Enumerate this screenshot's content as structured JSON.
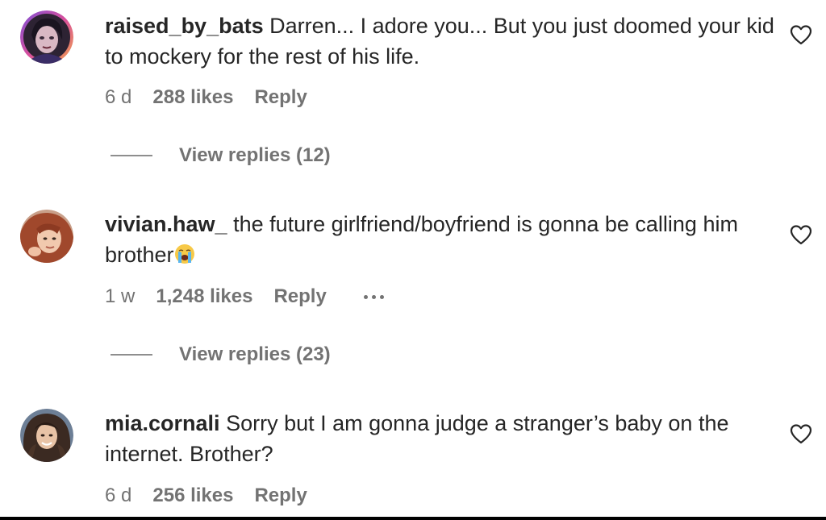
{
  "comments": [
    {
      "username": "raised_by_bats",
      "text": "Darren... I adore you... But you just doomed your kid to mockery for the rest of his life.",
      "age": "6 d",
      "likes": "288 likes",
      "reply": "Reply",
      "view_replies": "View replies (12)",
      "avatar_icon": "avatar-user-photo"
    },
    {
      "username": "vivian.haw_",
      "text": "the future girlfriend/boyfriend is gonna be calling him brother",
      "emoji": "loudly-crying-face",
      "age": "1 w",
      "likes": "1,248 likes",
      "reply": "Reply",
      "more_icon": "more-options-icon",
      "view_replies": "View replies (23)",
      "avatar_icon": "avatar-user-photo"
    },
    {
      "username": "mia.cornali",
      "text": "Sorry but I am gonna judge a stranger’s baby on the internet. Brother?",
      "age": "6 d",
      "likes": "256 likes",
      "reply": "Reply",
      "avatar_icon": "avatar-user-photo"
    }
  ],
  "colors": {
    "text": "#262626",
    "secondary": "#737373",
    "heart_stroke": "#262626"
  }
}
